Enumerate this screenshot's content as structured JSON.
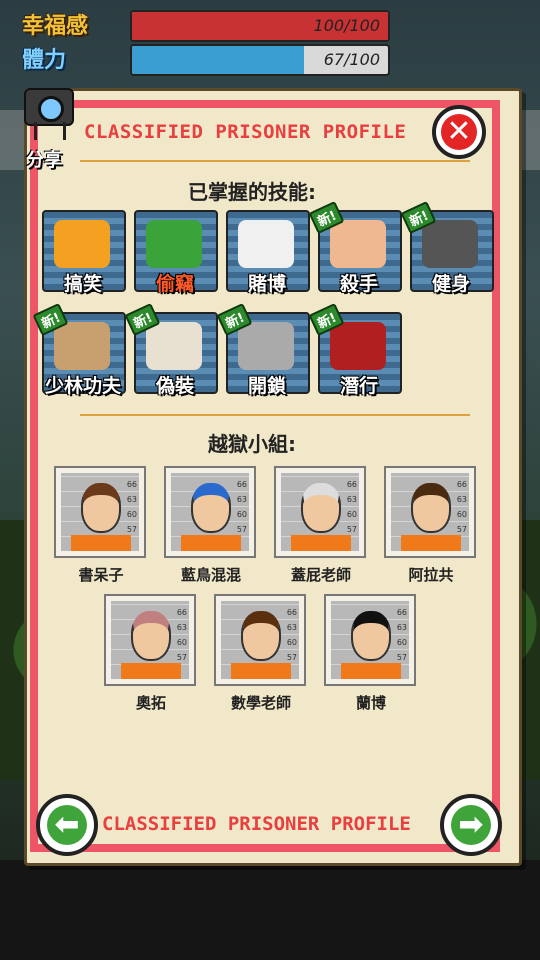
{
  "stats": [
    {
      "label": "幸福感",
      "value": "100/100",
      "fill_pct": 100,
      "color": "#c83232"
    },
    {
      "label": "體力",
      "value": "67/100",
      "fill_pct": 67,
      "color": "#3a9fd0"
    }
  ],
  "share_label": "分享",
  "header_title": "CLASSIFIED PRISONER PROFILE",
  "skills_heading": "已掌握的技能:",
  "skills": [
    {
      "label": "搞笑",
      "new": "",
      "color": "#f4a020"
    },
    {
      "label": "偷竊",
      "new": "",
      "color": "#3aa33a",
      "active": true
    },
    {
      "label": "賭博",
      "new": "",
      "color": "#f0f0f0"
    },
    {
      "label": "殺手",
      "new": "新!",
      "color": "#f0b890"
    },
    {
      "label": "健身",
      "new": "新!",
      "color": "#555555"
    },
    {
      "label": "少林功夫",
      "new": "新!",
      "color": "#c8a070"
    },
    {
      "label": "偽裝",
      "new": "新!",
      "color": "#e8e0d0"
    },
    {
      "label": "開鎖",
      "new": "新!",
      "color": "#aaaaaa"
    },
    {
      "label": "潛行",
      "new": "新!",
      "color": "#b02020"
    }
  ],
  "gang_heading": "越獄小組:",
  "gang": [
    {
      "name": "書呆子",
      "hair": "#6b3a1a"
    },
    {
      "name": "藍鳥混混",
      "hair": "#2a6acc"
    },
    {
      "name": "蓋屁老師",
      "hair": "#dddddd"
    },
    {
      "name": "阿拉共",
      "hair": "#4a2a10"
    },
    {
      "name": "奧拓",
      "hair": "#c08080"
    },
    {
      "name": "數學老師",
      "hair": "#5a3010"
    },
    {
      "name": "蘭博",
      "hair": "#111111"
    }
  ],
  "footer_title": "CLASSIFIED PRISONER PROFILE",
  "nav": {
    "prev": "⬅",
    "next": "➡"
  },
  "close_symbol": "✕",
  "mug_marks": [
    "66",
    "63",
    "60",
    "57"
  ]
}
